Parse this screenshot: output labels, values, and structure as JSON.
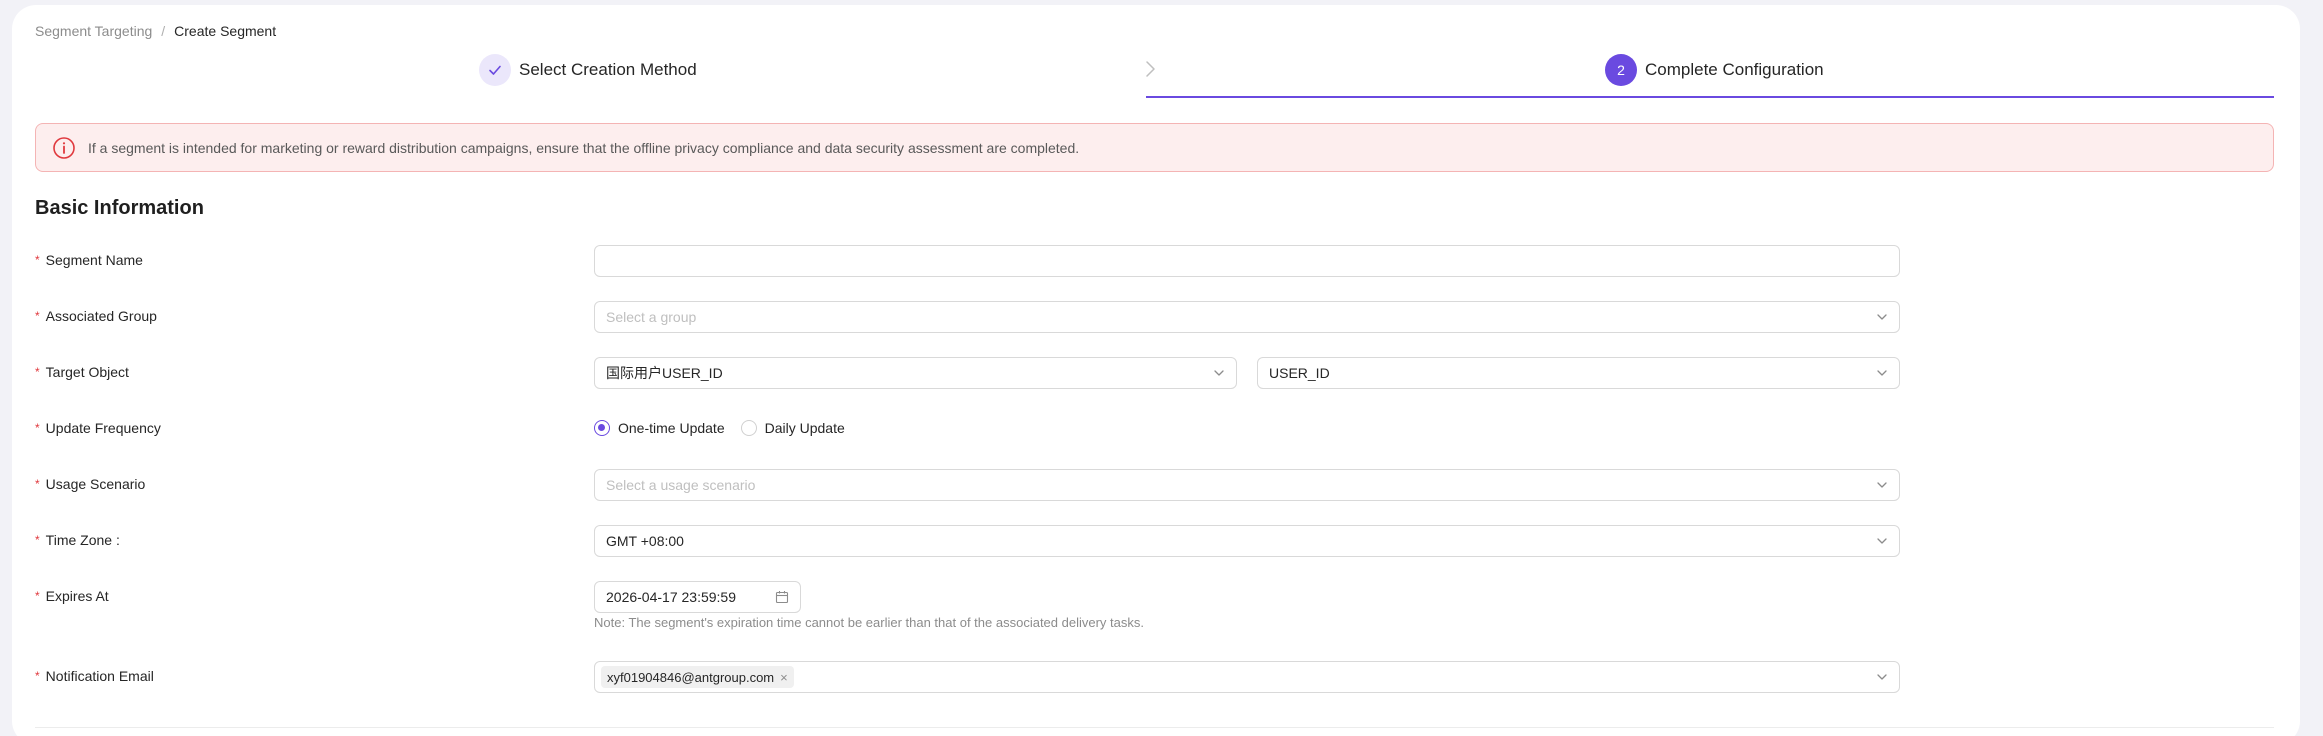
{
  "breadcrumb": {
    "parent": "Segment Targeting",
    "separator": "/",
    "current": "Create Segment"
  },
  "steps": {
    "step1": {
      "label": "Select Creation Method",
      "icon": "check-icon",
      "status": "completed"
    },
    "step2": {
      "number": "2",
      "label": "Complete Configuration",
      "status": "active"
    },
    "accent_color": "#6a4ae0"
  },
  "alert": {
    "icon": "info-circle-icon",
    "text": "If a segment is intended for marketing or reward distribution campaigns, ensure that the offline privacy compliance and data security assessment are completed.",
    "color": "#e0393e"
  },
  "section": {
    "title": "Basic Information"
  },
  "form": {
    "required_mark": "*",
    "segment_name": {
      "label": "Segment Name",
      "value": ""
    },
    "associated_group": {
      "label": "Associated Group",
      "placeholder": "Select a group"
    },
    "target_object": {
      "label": "Target Object",
      "primary_value": "国际用户USER_ID",
      "secondary_value": "USER_ID"
    },
    "update_frequency": {
      "label": "Update Frequency",
      "options": [
        {
          "label": "One-time Update",
          "selected": true
        },
        {
          "label": "Daily Update",
          "selected": false
        }
      ]
    },
    "usage_scenario": {
      "label": "Usage Scenario",
      "placeholder": "Select a usage scenario"
    },
    "time_zone": {
      "label": "Time Zone :",
      "value": "GMT +08:00"
    },
    "expires_at": {
      "label": "Expires At",
      "value": "2026-04-17 23:59:59",
      "note": "Note: The segment's expiration time cannot be earlier than that of the associated delivery tasks."
    },
    "notification_email": {
      "label": "Notification Email",
      "tags": [
        "xyf01904846@antgroup.com"
      ],
      "remove_glyph": "×"
    }
  }
}
